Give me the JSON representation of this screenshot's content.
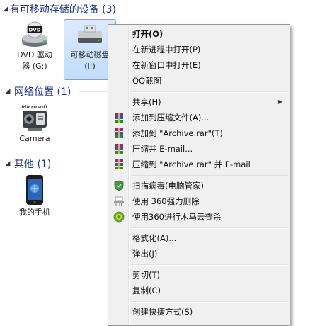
{
  "groups": [
    {
      "title": "有可移动存储的设备 (3)"
    },
    {
      "title": "网络位置 (1)"
    },
    {
      "title": "其他 (1)"
    }
  ],
  "devices": {
    "dvd": {
      "label": "DVD 驱动\n器 (G:)",
      "disc_text": "DVD"
    },
    "removable": {
      "label": "可移动磁盘\n(I:)"
    },
    "camera": {
      "label": "Camera",
      "brand_text": "Microsoft"
    },
    "phone": {
      "label": "我的手机"
    }
  },
  "context_menu": {
    "open": "打开(O)",
    "open_new_process": "在新进程中打开(P)",
    "open_new_window": "在新窗口中打开(E)",
    "qq_screenshot": "QQ截图",
    "share": "共享(H)",
    "add_to_archive": "添加到压缩文件(A)...",
    "add_to_archive_rar": "添加到 \"Archive.rar\"(T)",
    "compress_email": "压缩并 E-mail...",
    "compress_rar_email": "压缩到 \"Archive.rar\" 并 E-mail",
    "scan_virus": "扫描病毒(电脑管家)",
    "force_delete": "使用 360强力删除",
    "trojan_scan": "使用360进行木马云查杀",
    "format": "格式化(A)...",
    "eject": "弹出(J)",
    "cut": "剪切(T)",
    "copy": "复制(C)",
    "create_shortcut": "创建快捷方式(S)"
  }
}
